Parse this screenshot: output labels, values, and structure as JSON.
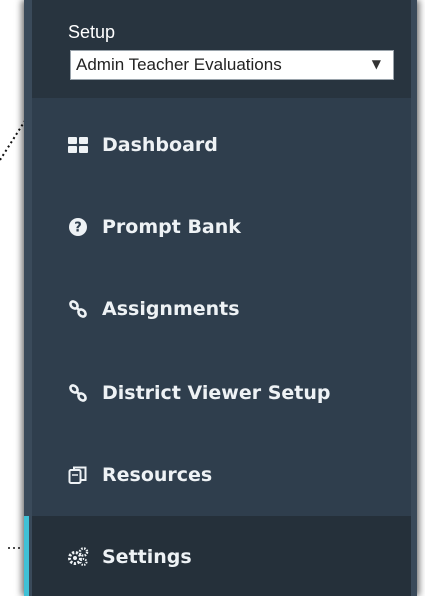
{
  "setup": {
    "label": "Setup",
    "select_value": "Admin Teacher Evaluations",
    "caret": "▼"
  },
  "nav": {
    "items": [
      {
        "label": "Dashboard",
        "icon": "dashboard-grid-icon"
      },
      {
        "label": "Prompt Bank",
        "icon": "question-circle-icon"
      },
      {
        "label": "Assignments",
        "icon": "link-icon"
      },
      {
        "label": "District Viewer Setup",
        "icon": "link-icon"
      },
      {
        "label": "Resources",
        "icon": "copy-icon"
      },
      {
        "label": "Settings",
        "icon": "gears-icon"
      }
    ],
    "active": "Settings"
  },
  "colors": {
    "panel_bg": "#2f3e4d",
    "header_bg": "#28343f",
    "active_bg": "#25303a",
    "active_accent": "#3fc1d6",
    "text": "#eef2f5"
  }
}
